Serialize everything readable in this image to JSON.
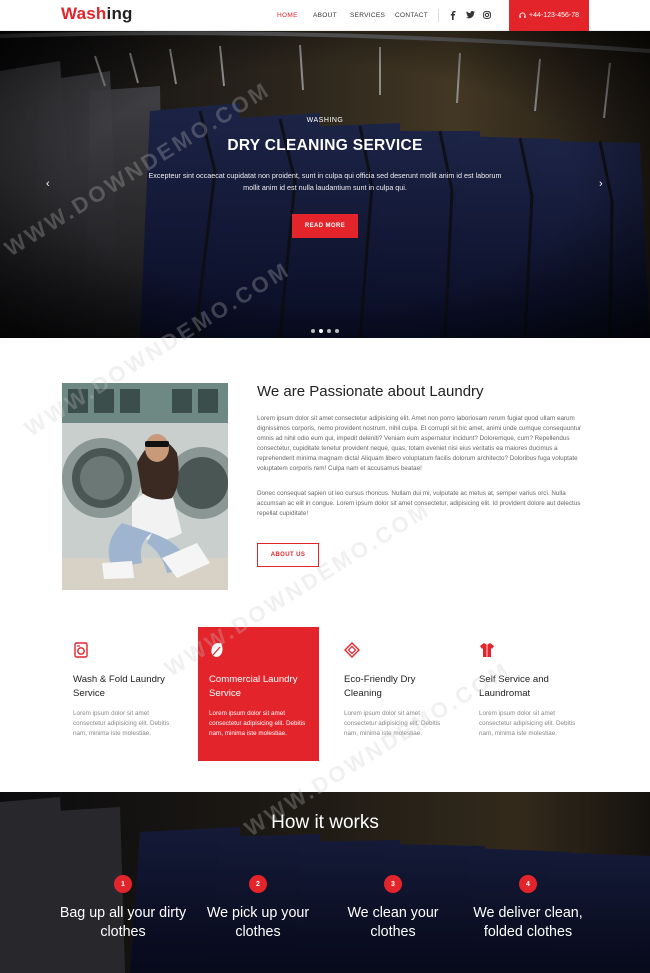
{
  "header": {
    "logo_a": "Wash",
    "logo_b": "ing",
    "nav": [
      "HOME",
      "ABOUT",
      "SERVICES",
      "CONTACT"
    ],
    "social_icons": [
      "facebook-icon",
      "twitter-icon",
      "instagram-icon"
    ],
    "phone": "+44-123-456-78",
    "accent": "#e3242b"
  },
  "hero": {
    "small": "WASHING",
    "title": "DRY CLEANING SERVICE",
    "desc": "Excepteur sint occaecat cupidatat non proident, sunt in culpa qui officia sed deserunt mollit anim id est laborum mollit anim id est nulla laudantium sunt in culpa qui.",
    "button": "READ MORE",
    "prev_arrow": "‹",
    "next_arrow": "›"
  },
  "about": {
    "title": "We are Passionate about Laundry",
    "p1": "Lorem ipsum dolor sit amet consectetur adipisicing elit. Amet non porro laboriosam rerum fugiat quod ullam earum dignissimos corporis, nemo provident nostrum, nihil culpa. Et corrupti sit hic amet, animi unde cumque consequuntur omnis ad nihil odio eum qui, impedit deleniti? Veniam eum aspernatur incidunt? Doloremque, cum? Repellendus consectetur, cupiditate tenetur provident neque, quas, totam eveniet nisi eius veritatis ea maiores ducimus a reprehenderit minima magnam dicta! Aliquam libero voluptatum facilis dolorum architecto? Doloribus fuga voluptate voluptatem corporis rem! Culpa nam et accusamus beatae!",
    "p2": "Donec consequat sapien ut leo cursus rhoncus. Nullam dui mi, vulputate ac metus at, semper varius orci. Nulla accumsan ac elit in congue. Lorem ipsum dolor sit amet consectetur, adipisicing elit. Id provident dolore aut delectus repellat cupiditate!",
    "button": "ABOUT US"
  },
  "services": [
    {
      "icon": "washing-machine-icon",
      "title": "Wash & Fold Laundry Service",
      "desc": "Lorem ipsum dolor sit amet consectetur adipisicing elit. Debitis nam, minima iste molestiae."
    },
    {
      "icon": "leaf-icon",
      "title": "Commercial Laundry Service",
      "desc": "Lorem ipsum dolor sit amet consectetur adipisicing elit. Debitis nam, minima iste molestiae."
    },
    {
      "icon": "cube-icon",
      "title": "Eco-Friendly Dry Cleaning",
      "desc": "Lorem ipsum dolor sit amet consectetur adipisicing elit. Debitis nam, minima iste molestiae."
    },
    {
      "icon": "shirt-icon",
      "title": "Self Service and Laundromat",
      "desc": "Lorem ipsum dolor sit amet consectetur adipisicing elit. Debitis nam, minima iste molestiae."
    }
  ],
  "how": {
    "title": "How it works",
    "steps": [
      {
        "num": "1",
        "label": "Bag up all your dirty clothes"
      },
      {
        "num": "2",
        "label": "We pick up your clothes"
      },
      {
        "num": "3",
        "label": "We clean your clothes"
      },
      {
        "num": "4",
        "label": "We deliver clean, folded clothes"
      }
    ]
  },
  "watermark": "WWW.DOWNDEMO.COM"
}
